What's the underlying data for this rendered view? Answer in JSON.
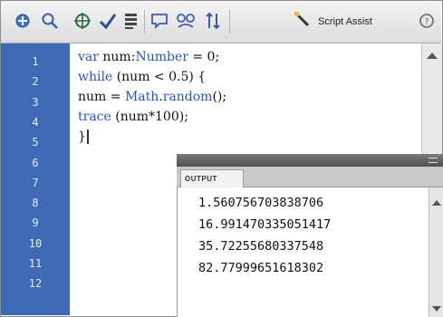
{
  "toolbar": {
    "icons": [
      "add-statement-icon",
      "find-icon",
      "target-icon",
      "check-syntax-icon",
      "auto-format-icon",
      "code-hint-icon",
      "debug-options-icon",
      "collapse-icon",
      "script-assist-icon",
      "help-icon"
    ],
    "script_assist_label": "Script Assist"
  },
  "editor": {
    "line_numbers": [
      "1",
      "2",
      "3",
      "4",
      "5",
      "6",
      "7",
      "8",
      "9",
      "10",
      "11",
      "12"
    ],
    "code": [
      [
        {
          "t": "var",
          "k": "kw"
        },
        {
          "t": " num:",
          "k": ""
        },
        {
          "t": "Number",
          "k": "kw"
        },
        {
          "t": " = 0;",
          "k": ""
        }
      ],
      [
        {
          "t": "while",
          "k": "kw"
        },
        {
          "t": " (num < 0.5) {",
          "k": ""
        }
      ],
      [
        {
          "t": "num = ",
          "k": ""
        },
        {
          "t": "Math",
          "k": "kw"
        },
        {
          "t": ".",
          "k": ""
        },
        {
          "t": "random",
          "k": "kw"
        },
        {
          "t": "();",
          "k": ""
        }
      ],
      [
        {
          "t": "trace",
          "k": "kw"
        },
        {
          "t": " (num*100);",
          "k": ""
        }
      ],
      [
        {
          "t": "}",
          "k": ""
        }
      ]
    ]
  },
  "output_panel": {
    "tab_label": "OUTPUT",
    "lines": [
      "1.560756703838706",
      "16.991470335051417",
      "35.72255680337548",
      "82.77999651618302"
    ]
  },
  "colors": {
    "gutter": "#3d6ab4",
    "keyword": "#2a55c0"
  }
}
